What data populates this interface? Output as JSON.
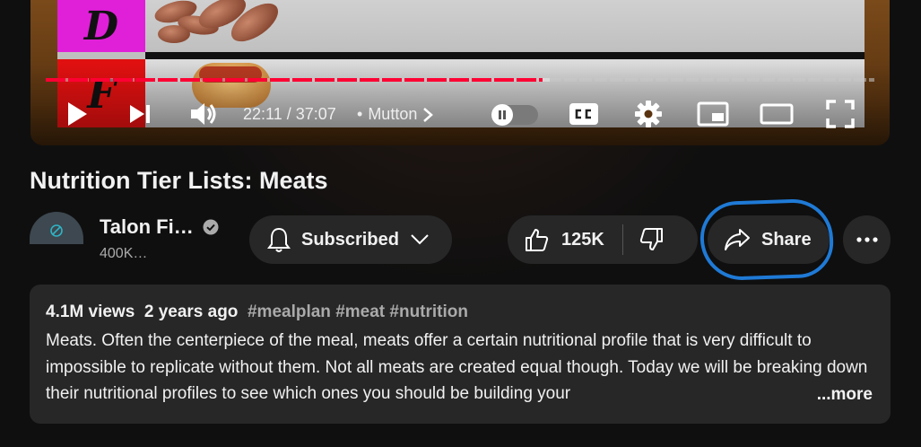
{
  "player": {
    "tier_d_letter": "D",
    "tier_f_letter": "F",
    "current_time": "22:11",
    "duration": "37:07",
    "time_separator": "/",
    "chapter_bullet": "•",
    "chapter": "Mutton",
    "progress_fraction": 0.6,
    "progress_color": "#ff0033",
    "autoplay_on": false
  },
  "video": {
    "title": "Nutrition Tier Lists: Meats"
  },
  "channel": {
    "name": "Talon Fi…",
    "subscribers": "400K…",
    "verified": true
  },
  "actions": {
    "subscribed_label": "Subscribed",
    "like_count": "125K",
    "share_label": "Share",
    "highlight_color": "#1f7ad6"
  },
  "description": {
    "views": "4.1M views",
    "age": "2 years ago",
    "tags": "#mealplan #meat #nutrition",
    "text": "Meats. Often the centerpiece of the meal, meats offer a certain nutritional profile that is very difficult to impossible to replicate without them. Not all meats are created equal though. Today we will be breaking down their nutritional profiles to see which ones you should be building your",
    "more_label": "...more"
  }
}
